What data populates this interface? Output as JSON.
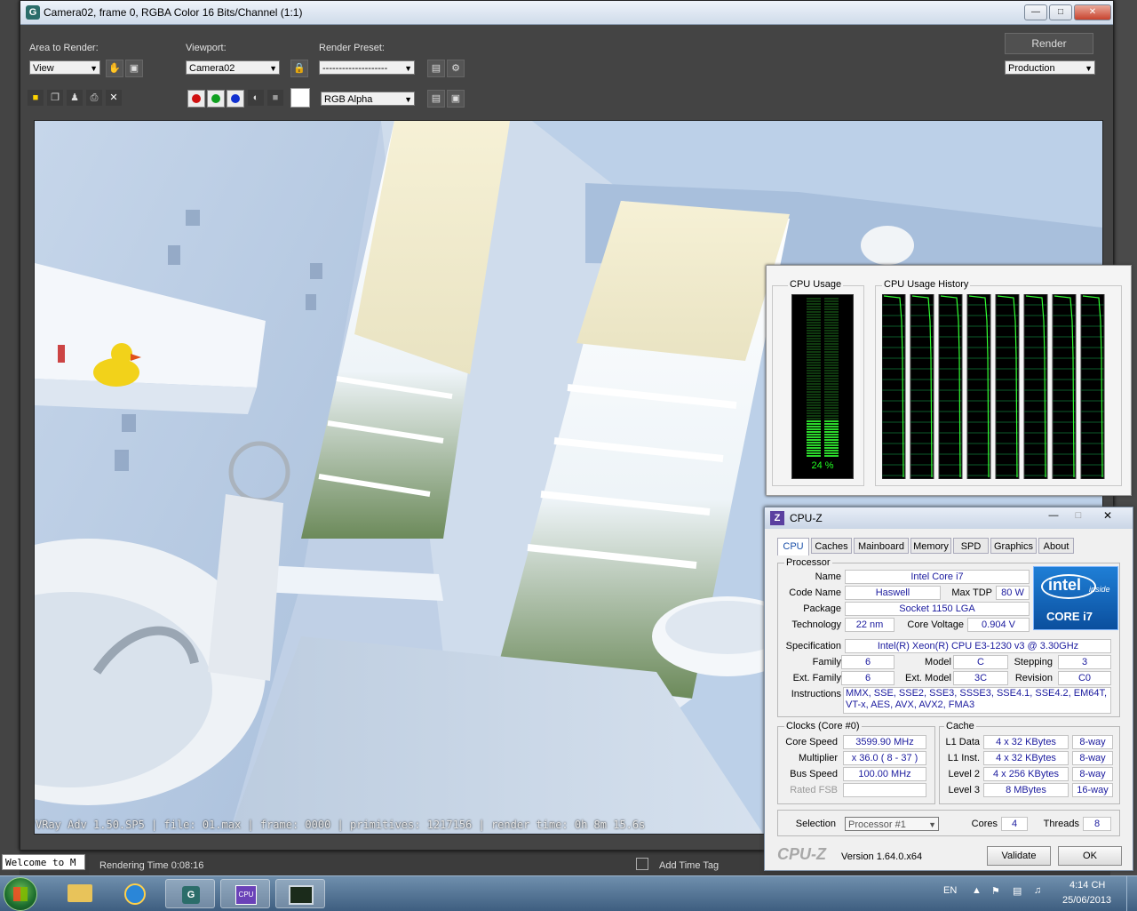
{
  "render_window": {
    "title": "Camera02, frame 0, RGBA Color 16 Bits/Channel (1:1)",
    "area_label": "Area to Render:",
    "area_value": "View",
    "viewport_label": "Viewport:",
    "viewport_value": "Camera02",
    "preset_label": "Render Preset:",
    "preset_value": "--------------------",
    "render_button": "Render",
    "production_value": "Production",
    "channel_value": "RGB Alpha",
    "status_line": "VRay Adv 1.50.SP5 | file: 01.max | frame: 0000 | primitives: 1217156 | render time: 0h 8m 15.6s"
  },
  "max_bottom": {
    "welcome": "Welcome to M",
    "rendering_time": "Rendering Time  0:08:16",
    "add_time_tag": "Add Time Tag"
  },
  "cpu_gadget": {
    "usage_title": "CPU Usage",
    "history_title": "CPU Usage History",
    "usage_percent": "24 %",
    "usage_value": 24,
    "core_count": 8
  },
  "cpuz": {
    "title": "CPU-Z",
    "tabs": [
      "CPU",
      "Caches",
      "Mainboard",
      "Memory",
      "SPD",
      "Graphics",
      "About"
    ],
    "processor_group": "Processor",
    "name_label": "Name",
    "name": "Intel Core i7",
    "codename_label": "Code Name",
    "codename": "Haswell",
    "maxtdp_label": "Max TDP",
    "maxtdp": "80 W",
    "package_label": "Package",
    "package": "Socket 1150 LGA",
    "technology_label": "Technology",
    "technology": "22 nm",
    "voltage_label": "Core Voltage",
    "voltage": "0.904 V",
    "spec_label": "Specification",
    "spec": "Intel(R) Xeon(R) CPU E3-1230 v3 @ 3.30GHz",
    "family_label": "Family",
    "family": "6",
    "model_label": "Model",
    "model": "C",
    "stepping_label": "Stepping",
    "stepping": "3",
    "extfamily_label": "Ext. Family",
    "extfamily": "6",
    "extmodel_label": "Ext. Model",
    "extmodel": "3C",
    "revision_label": "Revision",
    "revision": "C0",
    "instructions_label": "Instructions",
    "instructions": "MMX, SSE, SSE2, SSE3, SSSE3, SSE4.1, SSE4.2, EM64T, VT-x, AES, AVX, AVX2, FMA3",
    "clocks_group": "Clocks (Core #0)",
    "corespeed_label": "Core Speed",
    "corespeed": "3599.90 MHz",
    "multiplier_label": "Multiplier",
    "multiplier": "x 36.0 ( 8 - 37 )",
    "busspeed_label": "Bus Speed",
    "busspeed": "100.00 MHz",
    "ratedfsb_label": "Rated FSB",
    "ratedfsb": "",
    "cache_group": "Cache",
    "l1d_label": "L1 Data",
    "l1d": "4 x 32 KBytes",
    "l1d_way": "8-way",
    "l1i_label": "L1 Inst.",
    "l1i": "4 x 32 KBytes",
    "l1i_way": "8-way",
    "l2_label": "Level 2",
    "l2": "4 x 256 KBytes",
    "l2_way": "8-way",
    "l3_label": "Level 3",
    "l3": "8 MBytes",
    "l3_way": "16-way",
    "selection_label": "Selection",
    "selection": "Processor #1",
    "cores_label": "Cores",
    "cores": "4",
    "threads_label": "Threads",
    "threads": "8",
    "brand": "CPU-Z",
    "version": "Version 1.64.0.x64",
    "validate": "Validate",
    "ok": "OK",
    "intel_word": "intel",
    "intel_inside": "inside",
    "intel_core": "CORE i7"
  },
  "taskbar": {
    "lang": "EN",
    "time": "4:14 CH",
    "date": "25/06/2013"
  }
}
